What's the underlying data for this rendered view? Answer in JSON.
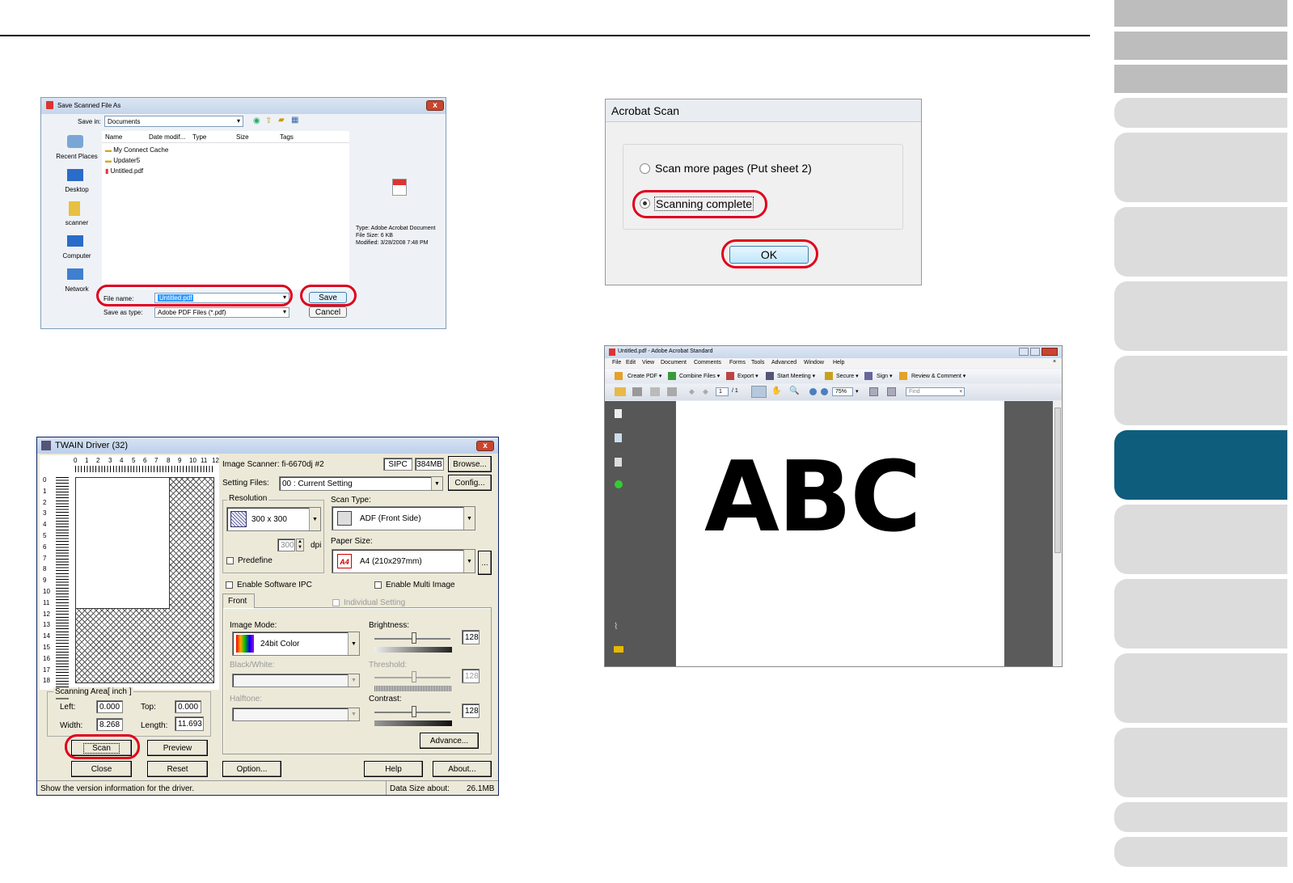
{
  "save_dialog": {
    "title": "Save Scanned File As",
    "save_in_label": "Save in:",
    "save_in_value": "Documents",
    "places": [
      "Recent Places",
      "Desktop",
      "scanner",
      "Computer",
      "Network"
    ],
    "columns": [
      "Name",
      "Date modif...",
      "Type",
      "Size",
      "Tags"
    ],
    "files": [
      "My Connect Cache",
      "Updater5",
      "Untitled.pdf"
    ],
    "preview_info": [
      "Type: Adobe Acrobat Document",
      "File Size: 6 KB",
      "Modified: 3/28/2008 7:48 PM"
    ],
    "filename_label": "File name:",
    "filename_value": "Untitled.pdf",
    "savetype_label": "Save as type:",
    "savetype_value": "Adobe PDF Files (*.pdf)",
    "save_btn": "Save",
    "cancel_btn": "Cancel"
  },
  "acrobat_scan": {
    "title": "Acrobat Scan",
    "option1": "Scan more pages (Put sheet 2)",
    "option2": "Scanning complete",
    "ok": "OK"
  },
  "acrobat_window": {
    "title": "Untitled.pdf - Adobe Acrobat Standard",
    "menu": [
      "File",
      "Edit",
      "View",
      "Document",
      "Comments",
      "Forms",
      "Tools",
      "Advanced",
      "Window",
      "Help"
    ],
    "toolbar": [
      "Create PDF",
      "Combine Files",
      "Export",
      "Start Meeting",
      "Secure",
      "Sign",
      "Review & Comment"
    ],
    "page_num": "1",
    "page_total": "/ 1",
    "zoom": "75%",
    "find_placeholder": "Find",
    "doc_text": "ABC"
  },
  "twain": {
    "title": "TWAIN Driver (32)",
    "ruler_top": [
      "0",
      "1",
      "2",
      "3",
      "4",
      "5",
      "6",
      "7",
      "8",
      "9",
      "10",
      "11",
      "12"
    ],
    "ruler_left": [
      "0",
      "1",
      "2",
      "3",
      "4",
      "5",
      "6",
      "7",
      "8",
      "9",
      "10",
      "11",
      "12",
      "13",
      "14",
      "15",
      "16",
      "17",
      "18"
    ],
    "scanner_label": "Image Scanner: fi-6670dj #2",
    "sipc": "SIPC",
    "mem": "384MB",
    "browse": "Browse...",
    "setting_files_label": "Setting Files:",
    "setting_files_value": "00 : Current Setting",
    "config": "Config...",
    "resolution_label": "Resolution",
    "resolution_value": "300 x 300",
    "dpi_value": "300",
    "dpi": "dpi",
    "predefine": "Predefine",
    "scan_type_label": "Scan Type:",
    "scan_type_value": "ADF (Front Side)",
    "paper_size_label": "Paper Size:",
    "paper_size_value": "A4 (210x297mm)",
    "dots": "...",
    "enable_ipc": "Enable Software IPC",
    "enable_multi": "Enable Multi Image",
    "tab_front": "Front",
    "individual": "Individual Setting",
    "image_mode_label": "Image Mode:",
    "image_mode_value": "24bit Color",
    "bw_label": "Black/White:",
    "halftone_label": "Halftone:",
    "brightness_label": "Brightness:",
    "brightness_value": "128",
    "threshold_label": "Threshold:",
    "threshold_value": "128",
    "contrast_label": "Contrast:",
    "contrast_value": "128",
    "advance": "Advance...",
    "area_label": "Scanning Area[ inch ]",
    "left_label": "Left:",
    "left_value": "0.000",
    "top_label": "Top:",
    "top_value": "0.000",
    "width_label": "Width:",
    "width_value": "8.268",
    "length_label": "Length:",
    "length_value": "11.693",
    "scan": "Scan",
    "preview": "Preview",
    "close": "Close",
    "reset": "Reset",
    "option": "Option...",
    "help": "Help",
    "about": "About...",
    "status": "Show the version information for the driver.",
    "data_size_label": "Data Size about:",
    "data_size_value": "26.1MB"
  }
}
